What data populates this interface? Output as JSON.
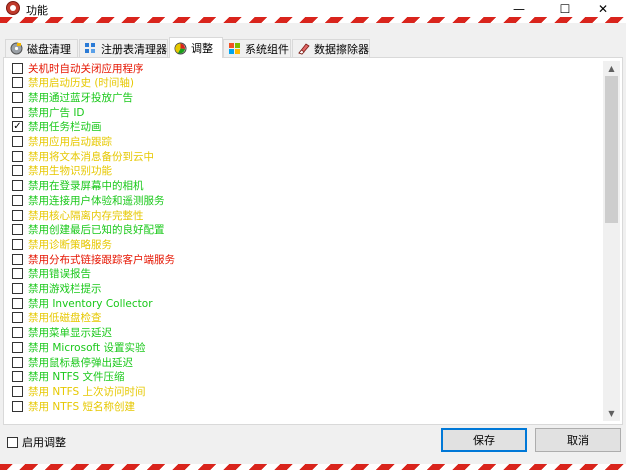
{
  "window": {
    "title": "功能",
    "minimize": "—",
    "maximize": "☐",
    "close": "✕"
  },
  "tabs": [
    {
      "label": "磁盘清理",
      "icon": "disk-cleanup-icon"
    },
    {
      "label": "注册表清理器",
      "icon": "registry-icon"
    },
    {
      "label": "调整",
      "icon": "tweaks-icon",
      "active": true
    },
    {
      "label": "系统组件",
      "icon": "windows-logo-icon"
    },
    {
      "label": "数据擦除器",
      "icon": "eraser-icon"
    }
  ],
  "options": [
    {
      "label": "关机时自动关闭应用程序",
      "color": "#e51400",
      "checked": false
    },
    {
      "label": "禁用启动历史 (时间轴)",
      "color": "#e6c800",
      "checked": false
    },
    {
      "label": "禁用通过蓝牙投放广告",
      "color": "#19c819",
      "checked": false
    },
    {
      "label": "禁用广告 ID",
      "color": "#19c819",
      "checked": false
    },
    {
      "label": "禁用任务栏动画",
      "color": "#19c819",
      "checked": true
    },
    {
      "label": "禁用应用启动跟踪",
      "color": "#e6c800",
      "checked": false
    },
    {
      "label": "禁用将文本消息备份到云中",
      "color": "#e6c800",
      "checked": false
    },
    {
      "label": "禁用生物识别功能",
      "color": "#e6c800",
      "checked": false
    },
    {
      "label": "禁用在登录屏幕中的相机",
      "color": "#19c819",
      "checked": false
    },
    {
      "label": "禁用连接用户体验和遥测服务",
      "color": "#19c819",
      "checked": false
    },
    {
      "label": "禁用核心隔离内存完整性",
      "color": "#e6c800",
      "checked": false
    },
    {
      "label": "禁用创建最后已知的良好配置",
      "color": "#19c819",
      "checked": false
    },
    {
      "label": "禁用诊断策略服务",
      "color": "#e6c800",
      "checked": false
    },
    {
      "label": "禁用分布式链接跟踪客户端服务",
      "color": "#e51400",
      "checked": false
    },
    {
      "label": "禁用错误报告",
      "color": "#19c819",
      "checked": false
    },
    {
      "label": "禁用游戏栏提示",
      "color": "#19c819",
      "checked": false
    },
    {
      "label": "禁用 Inventory Collector",
      "color": "#19c819",
      "checked": false
    },
    {
      "label": "禁用低磁盘检查",
      "color": "#e6c800",
      "checked": false
    },
    {
      "label": "禁用菜单显示延迟",
      "color": "#19c819",
      "checked": false
    },
    {
      "label": "禁用 Microsoft 设置实验",
      "color": "#19c819",
      "checked": false
    },
    {
      "label": "禁用鼠标悬停弹出延迟",
      "color": "#19c819",
      "checked": false
    },
    {
      "label": "禁用 NTFS 文件压缩",
      "color": "#19c819",
      "checked": false
    },
    {
      "label": "禁用 NTFS 上次访问时间",
      "color": "#e6c800",
      "checked": false
    },
    {
      "label": "禁用 NTFS 短名称创建",
      "color": "#e6c800",
      "checked": false
    }
  ],
  "footer": {
    "enable_label": "启用调整",
    "save": "保存",
    "cancel": "取消"
  },
  "scroll": {
    "up": "▲",
    "down": "▼"
  },
  "colors": {
    "stripe_red": "#d9241c",
    "accent_border": "#0078d7"
  }
}
